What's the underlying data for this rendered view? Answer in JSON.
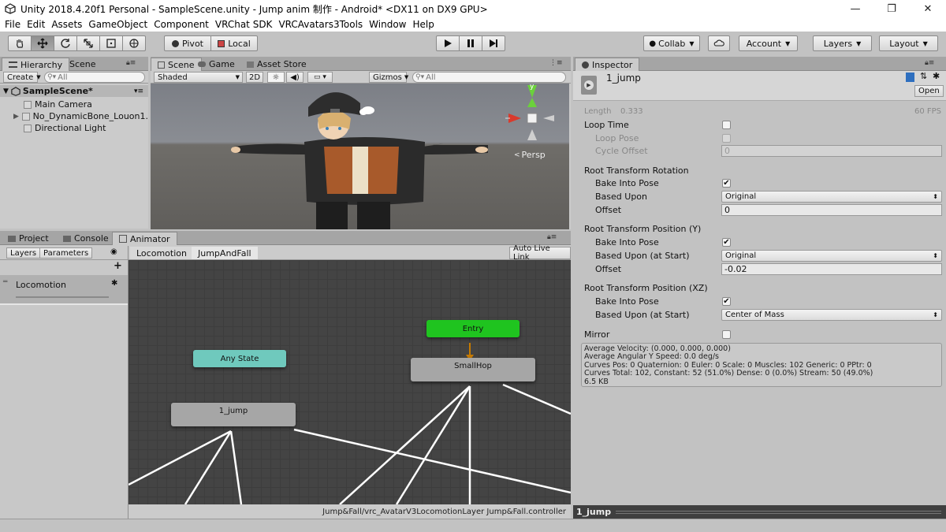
{
  "window": {
    "title": "Unity 2018.4.20f1 Personal - SampleScene.unity - Jump anim 制作 - Android* <DX11 on DX9 GPU>",
    "minimize": "—",
    "restore": "❐",
    "close": "✕"
  },
  "menu": [
    "File",
    "Edit",
    "Assets",
    "GameObject",
    "Component",
    "VRChat SDK",
    "VRCAvatars3Tools",
    "Window",
    "Help"
  ],
  "toolbar": {
    "pivot": "Pivot",
    "local": "Local",
    "collab": "Collab",
    "account": "Account",
    "layers": "Layers",
    "layout": "Layout"
  },
  "hierarchy": {
    "tab": "Hierarchy",
    "tab2": "Scene",
    "create": "Create",
    "search_placeholder": "All",
    "scene": "SampleScene*",
    "items": [
      "Main Camera",
      "No_DynamicBone_Louon1.",
      "Directional Light"
    ]
  },
  "scene": {
    "tabs": [
      "Scene",
      "Game",
      "Asset Store"
    ],
    "shading": "Shaded",
    "mode2d": "2D",
    "gizmos": "Gizmos",
    "search_placeholder": "All",
    "persp": "Persp",
    "gizmo_y": "y"
  },
  "animator": {
    "tabs": [
      "Project",
      "Console",
      "Animator"
    ],
    "subtabs": [
      "Layers",
      "Parameters"
    ],
    "add": "+",
    "layer": "Locomotion",
    "breadcrumb": [
      "Locomotion",
      "JumpAndFall"
    ],
    "auto_live_link": "Auto Live Link",
    "status_path": "Jump&Fall/vrc_AvatarV3LocomotionLayer Jump&Fall.controller",
    "nodes": {
      "entry": "Entry",
      "any_state": "Any State",
      "small_hop": "SmallHop",
      "jump": "1_jump"
    },
    "colors": {
      "entry": "#1fc41f",
      "any_state": "#6fc9bd",
      "state": "#a6a6a6"
    }
  },
  "inspector": {
    "tab": "Inspector",
    "clip_name": "1_jump",
    "open": "Open",
    "length_label": "Length",
    "length_value": "0.333",
    "fps": "60 FPS",
    "loop_time": "Loop Time",
    "loop_pose": "Loop Pose",
    "cycle_offset": "Cycle Offset",
    "cycle_offset_value": "0",
    "root_rotation": "Root Transform Rotation",
    "bake_into_pose": "Bake Into Pose",
    "based_upon": "Based Upon",
    "based_upon_value": "Original",
    "offset": "Offset",
    "rot_offset_value": "0",
    "root_pos_y": "Root Transform Position (Y)",
    "based_upon_start": "Based Upon (at Start)",
    "y_based_value": "Original",
    "y_offset_value": "-0.02",
    "root_pos_xz": "Root Transform Position (XZ)",
    "xz_based_value": "Center of Mass",
    "mirror": "Mirror",
    "info": [
      "Average Velocity: (0.000, 0.000, 0.000)",
      "Average Angular Y Speed: 0.0 deg/s",
      "Curves Pos: 0 Quaternion: 0 Euler: 0 Scale: 0 Muscles: 102 Generic: 0 PPtr: 0",
      "Curves Total: 102, Constant: 52 (51.0%) Dense: 0 (0.0%) Stream: 50 (49.0%)",
      "6.5 KB"
    ],
    "preview_title": "1_jump"
  }
}
